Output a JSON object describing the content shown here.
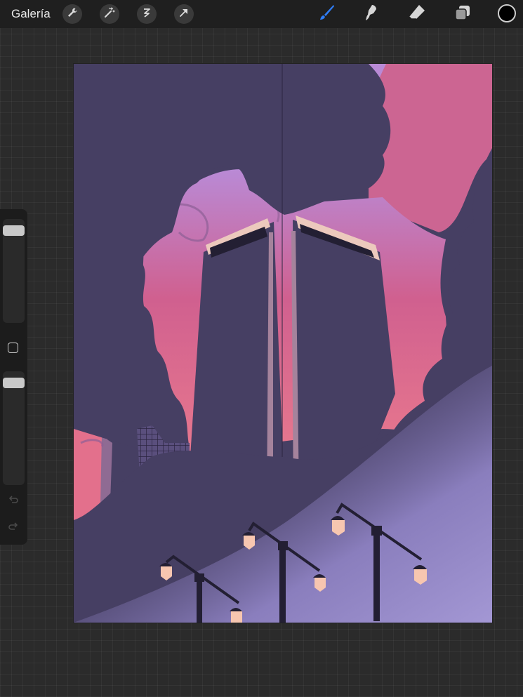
{
  "topbar": {
    "gallery_label": "Galería",
    "actions": [
      {
        "name": "wrench-icon"
      },
      {
        "name": "magic-wand-icon"
      },
      {
        "name": "selection-icon"
      },
      {
        "name": "transform-arrow-icon"
      }
    ],
    "tools": [
      {
        "name": "brush-icon",
        "active": true
      },
      {
        "name": "smudge-icon",
        "active": false
      },
      {
        "name": "eraser-icon",
        "active": false
      },
      {
        "name": "layers-icon",
        "active": false
      }
    ],
    "current_color": "#000000",
    "active_tool_color": "#2f7df6"
  },
  "sidebar": {
    "brush_size": 0.97,
    "opacity": 0.97,
    "modify_icon": "square-icon",
    "undo_icon": "undo-icon",
    "redo_icon": "redo-icon"
  },
  "canvas": {
    "palette": {
      "dark": "#463f63",
      "pink": "#d0608f",
      "lilac": "#b98ad6",
      "rose": "#e8788e",
      "lamp": "#f7c6b0",
      "pole": "#231f33",
      "trim": "#ecc9bd",
      "glow": "#9f90cd"
    }
  }
}
